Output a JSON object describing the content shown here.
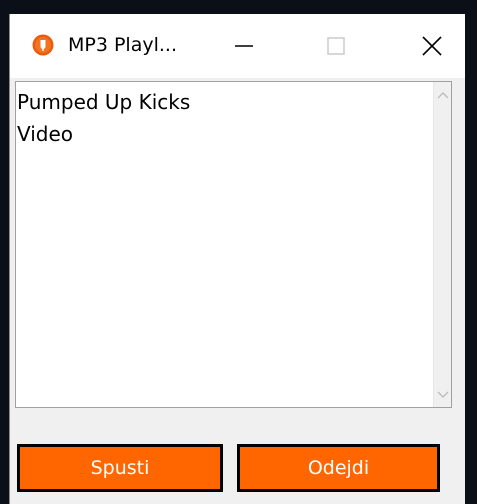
{
  "window": {
    "title": "MP3 Playl...",
    "icon": "orange-circle-app-icon",
    "controls": {
      "minimize": "minimize-icon",
      "maximize": "maximize-icon",
      "close": "close-icon"
    }
  },
  "playlist": {
    "items": [
      {
        "label": "Pumped Up Kicks"
      },
      {
        "label": "Video"
      }
    ]
  },
  "buttons": {
    "spusti_label": "Spusti",
    "odejdi_label": "Odejdi"
  },
  "colors": {
    "button_bg": "#ff6600",
    "button_border": "#000000",
    "button_text": "#ffffff"
  }
}
